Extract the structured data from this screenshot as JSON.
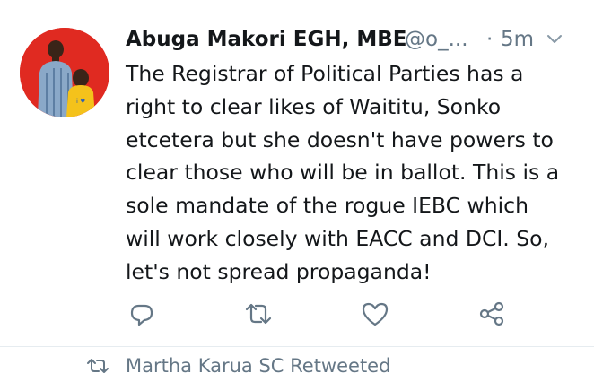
{
  "tweet": {
    "author_name": "Abuga Makori EGH, MBE",
    "author_handle": "@o_...",
    "separator": "·",
    "time": "5m",
    "text": "The Registrar of Political Parties has a\nright to clear likes of Waititu, Sonko\netcetera but she doesn't have powers to\nclear those who will be in ballot. This is a\nsole mandate of the rogue IEBC which\nwill work closely with EACC and DCI. So,\nlet's not spread propaganda!",
    "icons": {
      "reply": "reply-icon",
      "retweet": "retweet-icon",
      "like": "like-icon",
      "share": "share-icon",
      "more": "chevron-down-icon"
    }
  },
  "retweet_context": {
    "label": "Martha Karua SC Retweeted",
    "icon": "retweet-icon"
  },
  "colors": {
    "text": "#14171a",
    "secondary": "#657786",
    "divider": "#e6ecf0",
    "avatar_background": "#e02a21"
  }
}
